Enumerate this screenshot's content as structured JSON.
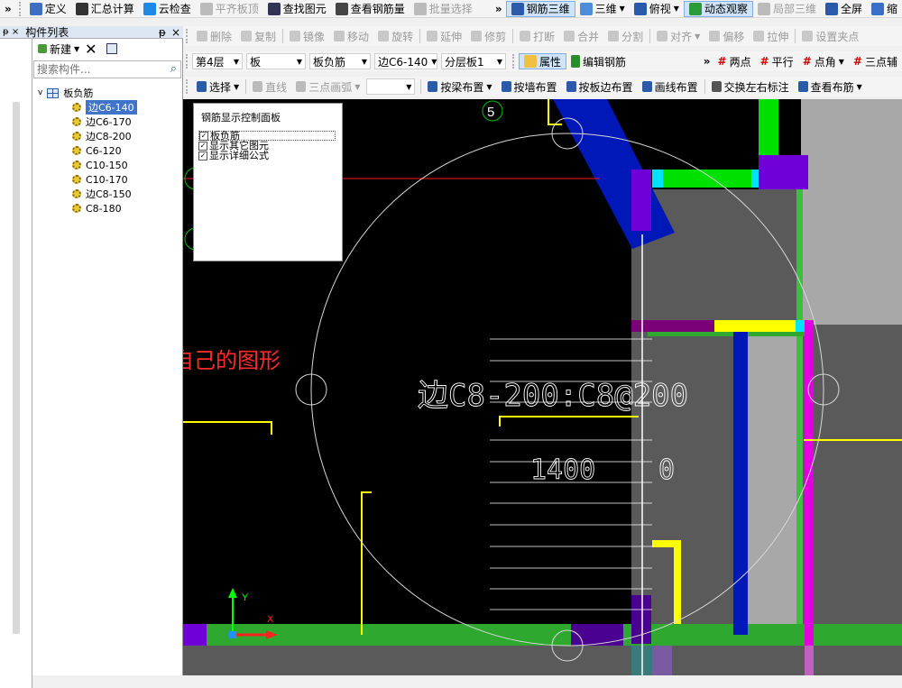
{
  "toolbar1": {
    "items": [
      {
        "label": "定义",
        "icon": "define-icon",
        "state": "normal"
      },
      {
        "label": "汇总计算",
        "icon": "sum-icon",
        "state": "normal"
      },
      {
        "label": "云检查",
        "icon": "cloud-check-icon",
        "state": "normal"
      },
      {
        "label": "平齐板顶",
        "icon": "align-top-icon",
        "state": "disabled"
      },
      {
        "label": "查找图元",
        "icon": "find-icon",
        "state": "normal"
      },
      {
        "label": "查看钢筋量",
        "icon": "rebar-qty-icon",
        "state": "normal"
      },
      {
        "label": "批量选择",
        "icon": "batch-select-icon",
        "state": "disabled"
      },
      {
        "label": "钢筋三维",
        "icon": "rebar-3d-icon",
        "state": "active"
      },
      {
        "label": "三维",
        "icon": "cube-icon",
        "state": "normal"
      },
      {
        "label": "俯视",
        "icon": "topview-icon",
        "state": "normal"
      },
      {
        "label": "动态观察",
        "icon": "orbit-icon",
        "state": "active"
      },
      {
        "label": "局部三维",
        "icon": "local-3d-icon",
        "state": "disabled"
      },
      {
        "label": "全屏",
        "icon": "fullscreen-icon",
        "state": "normal"
      },
      {
        "label": "缩",
        "icon": "zoom-icon",
        "state": "normal"
      }
    ]
  },
  "panel": {
    "title": "构件列表",
    "pin": "ᵽ",
    "close": "×",
    "new_label": "新建",
    "search_placeholder": "搜索构件...",
    "tree_root": "板负筋",
    "items": [
      "边C6-140",
      "边C6-170",
      "边C8-200",
      "C6-120",
      "C10-150",
      "C10-170",
      "边C8-150",
      "C8-180"
    ],
    "selected_index": 0
  },
  "toolbar2": {
    "items": [
      {
        "label": "删除",
        "icon": "delete-icon"
      },
      {
        "label": "复制",
        "icon": "copy-icon"
      },
      {
        "label": "镜像",
        "icon": "mirror-icon"
      },
      {
        "label": "移动",
        "icon": "move-icon"
      },
      {
        "label": "旋转",
        "icon": "rotate-icon"
      },
      {
        "label": "延伸",
        "icon": "extend-icon"
      },
      {
        "label": "修剪",
        "icon": "trim-icon"
      },
      {
        "label": "打断",
        "icon": "break-icon"
      },
      {
        "label": "合并",
        "icon": "merge-icon"
      },
      {
        "label": "分割",
        "icon": "split-icon"
      },
      {
        "label": "对齐",
        "icon": "align-icon"
      },
      {
        "label": "偏移",
        "icon": "offset-icon"
      },
      {
        "label": "拉伸",
        "icon": "stretch-icon"
      },
      {
        "label": "设置夹点",
        "icon": "grip-point-icon"
      }
    ]
  },
  "toolbar3": {
    "floor": "第4层",
    "type": "板",
    "category": "板负筋",
    "component": "边C6-140",
    "layer": "分层板1",
    "property": "属性",
    "edit_rebar": "编辑钢筋",
    "right": [
      "两点",
      "平行",
      "点角",
      "三点辅"
    ]
  },
  "toolbar4": {
    "items": [
      {
        "label": "选择",
        "icon": "cursor-icon",
        "state": "normal"
      },
      {
        "label": "直线",
        "icon": "line-icon",
        "state": "disabled"
      },
      {
        "label": "三点画弧",
        "icon": "arc-icon",
        "state": "disabled"
      },
      {
        "label": "按梁布置",
        "icon": "beam-layout-icon",
        "state": "normal"
      },
      {
        "label": "按墙布置",
        "icon": "wall-layout-icon",
        "state": "normal"
      },
      {
        "label": "按板边布置",
        "icon": "slab-edge-icon",
        "state": "normal"
      },
      {
        "label": "画线布置",
        "icon": "draw-line-icon",
        "state": "normal"
      },
      {
        "label": "交换左右标注",
        "icon": "swap-label-icon",
        "state": "normal"
      },
      {
        "label": "查看布筋",
        "icon": "view-rebar-icon",
        "state": "normal"
      }
    ]
  },
  "control_panel": {
    "title": "钢筋显示控制面板",
    "options": [
      {
        "label": "板负筋",
        "checked": true
      },
      {
        "label": "显示其它图元",
        "checked": true
      },
      {
        "label": "显示详细公式",
        "checked": true
      }
    ]
  },
  "canvas": {
    "annotation": "自己的图形",
    "rebar_label": "边C8-200:C8@200",
    "dim_left": "1400",
    "dim_right": "0",
    "axis_number": "5",
    "axis_x": "X",
    "axis_y": "Y"
  },
  "colors": {
    "accent_red": "#ff2b2b",
    "yellow": "#ffff00",
    "green": "#00e000",
    "blue": "#0018b8",
    "magenta": "#e000e0",
    "purple": "#7000d8",
    "cyan": "#00e0ff",
    "gray": "#5a5a5a",
    "lightgray": "#a8a8a8"
  }
}
